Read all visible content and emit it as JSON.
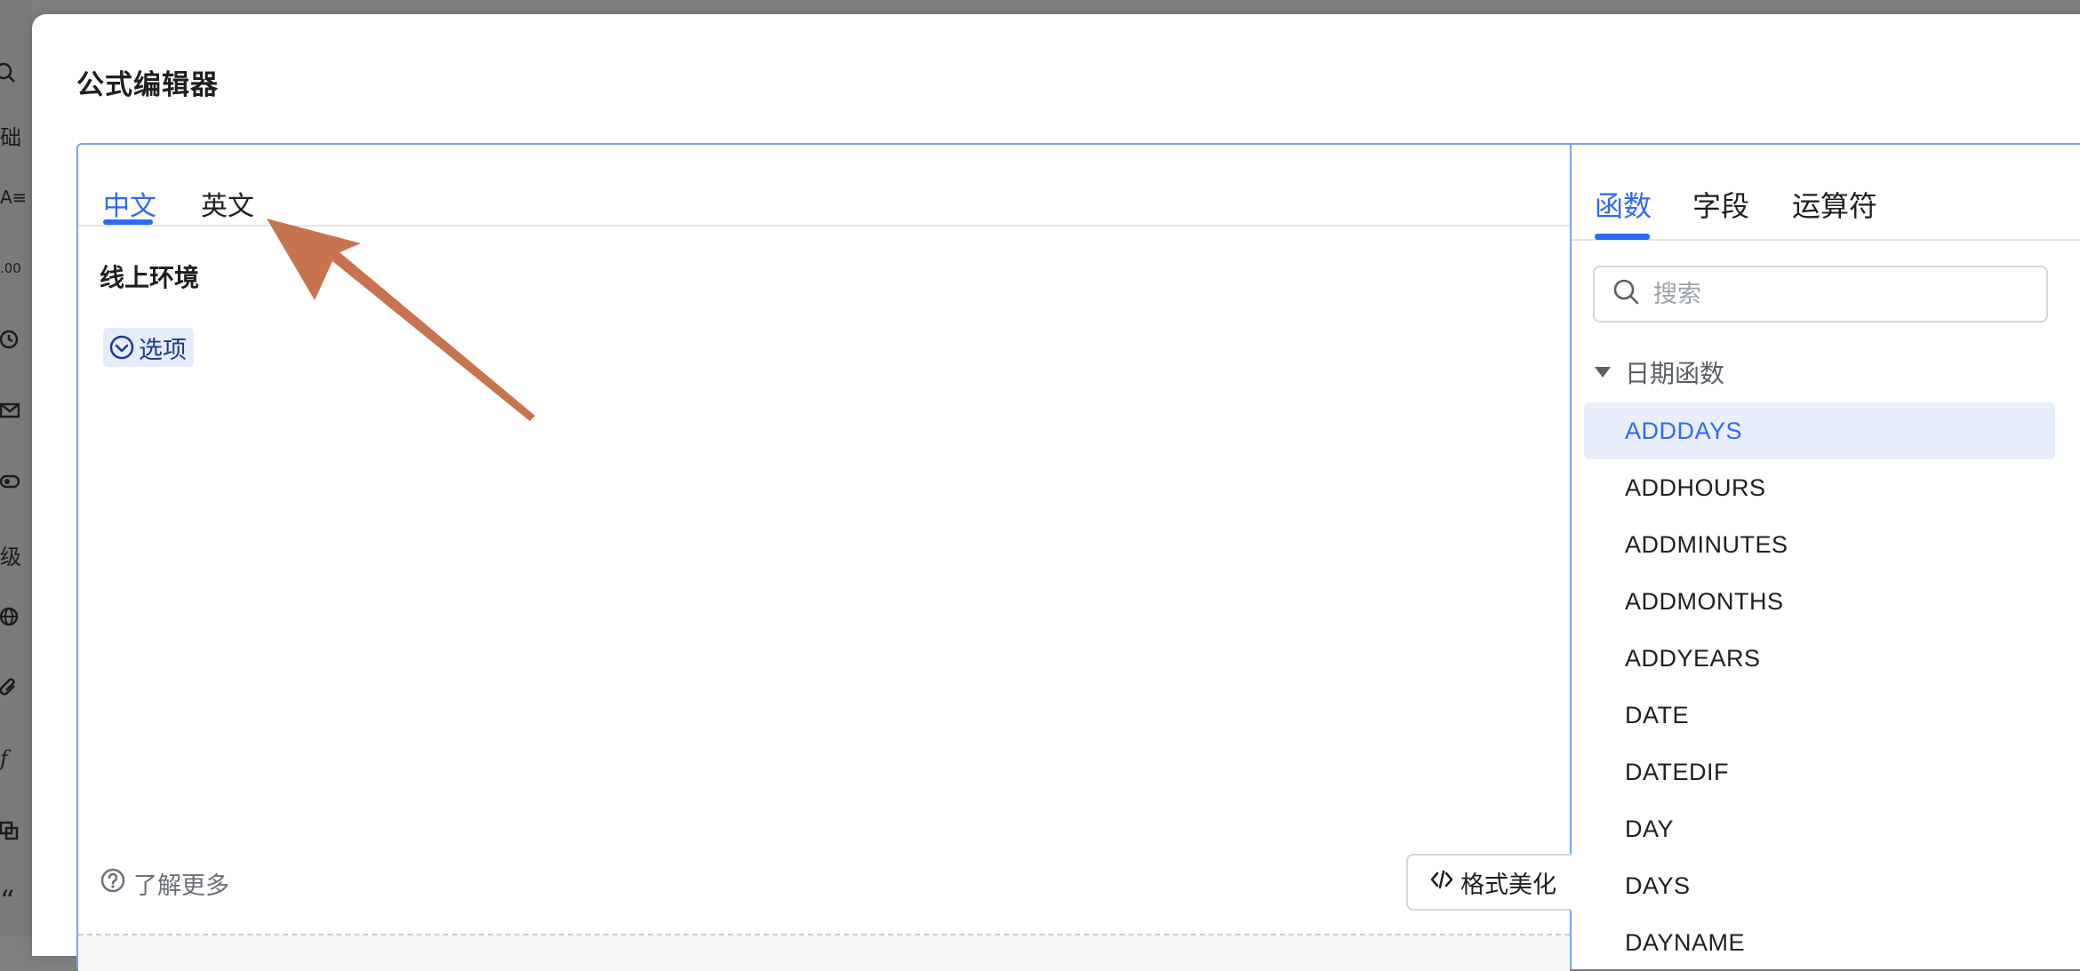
{
  "modal": {
    "title": "公式编辑器"
  },
  "editor": {
    "tabs": [
      {
        "label": "中文",
        "active": true
      },
      {
        "label": "英文",
        "active": false
      }
    ],
    "environment": "线上环境",
    "option_chip": {
      "label": "选项",
      "icon": "chevron-down-circle-icon"
    },
    "learn_more": {
      "label": "了解更多",
      "icon": "question-circle-icon"
    },
    "beautify_button": {
      "label": "格式美化",
      "icon": "code-icon"
    }
  },
  "right_panel": {
    "tabs": [
      {
        "label": "函数",
        "active": true
      },
      {
        "label": "字段",
        "active": false
      },
      {
        "label": "运算符",
        "active": false
      }
    ],
    "search": {
      "placeholder": "搜索",
      "value": ""
    },
    "group": {
      "label": "日期函数",
      "expanded": true
    },
    "functions": [
      {
        "name": "ADDDAYS",
        "selected": true
      },
      {
        "name": "ADDHOURS",
        "selected": false
      },
      {
        "name": "ADDMINUTES",
        "selected": false
      },
      {
        "name": "ADDMONTHS",
        "selected": false
      },
      {
        "name": "ADDYEARS",
        "selected": false
      },
      {
        "name": "DATE",
        "selected": false
      },
      {
        "name": "DATEDIF",
        "selected": false
      },
      {
        "name": "DAY",
        "selected": false
      },
      {
        "name": "DAYS",
        "selected": false
      },
      {
        "name": "DAYNAME",
        "selected": false
      }
    ]
  },
  "background_sidebar": {
    "visible_labels": [
      "础",
      "级"
    ]
  },
  "colors": {
    "accent": "#2f6bf1",
    "annotation_arrow": "#c8734f",
    "selected_row_bg": "#e8eefc"
  }
}
